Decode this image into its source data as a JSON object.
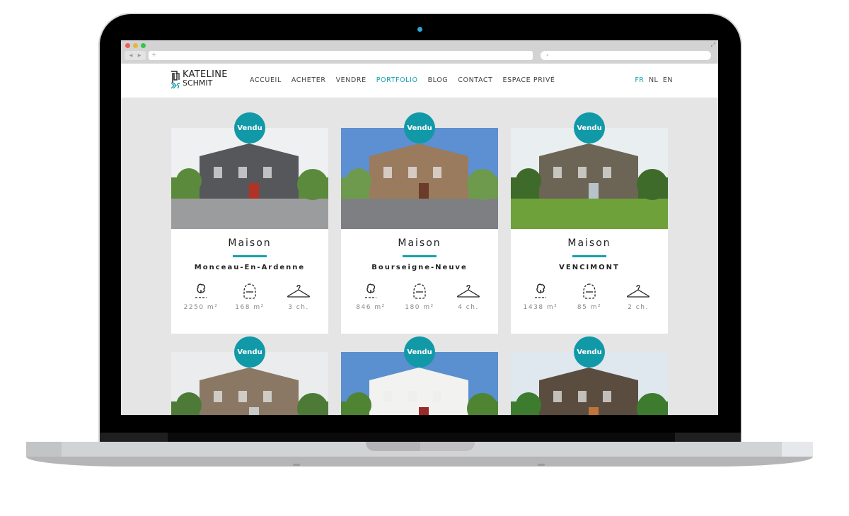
{
  "browser": {
    "url_placeholder": "+",
    "search_placeholder": "⌕",
    "nav_back": "◀",
    "nav_forward": "▶",
    "expand_icon": "⤢",
    "traffic_lights": [
      "#ec5f57",
      "#e5b73b",
      "#35c64a"
    ]
  },
  "site": {
    "logo": {
      "line1": "KATELINE",
      "line2": "SCHMIT",
      "mark_letters": "KS"
    },
    "menu": [
      {
        "label": "ACCUEIL",
        "active": false
      },
      {
        "label": "ACHETER",
        "active": false
      },
      {
        "label": "VENDRE",
        "active": false
      },
      {
        "label": "PORTFOLIO",
        "active": true
      },
      {
        "label": "BLOG",
        "active": false
      },
      {
        "label": "CONTACT",
        "active": false
      },
      {
        "label": "ESPACE PRIVÉ",
        "active": false
      }
    ],
    "languages": [
      {
        "label": "FR",
        "active": true
      },
      {
        "label": "NL",
        "active": false
      },
      {
        "label": "EN",
        "active": false
      }
    ],
    "accent_color": "#17a0ae"
  },
  "listings": [
    {
      "badge": "Vendu",
      "type": "Maison",
      "location": "Monceau-En-Ardenne",
      "land": "2250 m²",
      "living": "168 m²",
      "rooms": "3 ch.",
      "photo": {
        "sky": "#eef0f2",
        "main": "#55575a",
        "ground": "#9b9c9d",
        "accent": "#b23325",
        "green": "#5c8a3c"
      }
    },
    {
      "badge": "Vendu",
      "type": "Maison",
      "location": "Bourseigne-Neuve",
      "land": "846 m²",
      "living": "180 m²",
      "rooms": "4 ch.",
      "photo": {
        "sky": "#5d8fd3",
        "main": "#9a7b5e",
        "ground": "#7e7f82",
        "accent": "#6b3c2a",
        "green": "#6e9a4e"
      }
    },
    {
      "badge": "Vendu",
      "type": "Maison",
      "location": "VENCIMONT",
      "land": "1438 m²",
      "living": "85 m²",
      "rooms": "2 ch.",
      "photo": {
        "sky": "#e9eef0",
        "main": "#6c6455",
        "ground": "#6ea13a",
        "accent": "#b7c3c8",
        "green": "#3f6b2a"
      }
    },
    {
      "badge": "Vendu",
      "photo": {
        "sky": "#eaecee",
        "main": "#8a7864",
        "ground": "#888",
        "accent": "#c7c9cb",
        "green": "#4d7a37"
      }
    },
    {
      "badge": "Vendu",
      "photo": {
        "sky": "#5a8fd0",
        "main": "#f2f2f0",
        "ground": "#555",
        "accent": "#9a2b2b",
        "green": "#4f8433"
      }
    },
    {
      "badge": "Vendu",
      "photo": {
        "sky": "#dfe7ef",
        "main": "#5a4d3f",
        "ground": "#5f9a36",
        "accent": "#c0743a",
        "green": "#3d7b2e"
      }
    }
  ]
}
